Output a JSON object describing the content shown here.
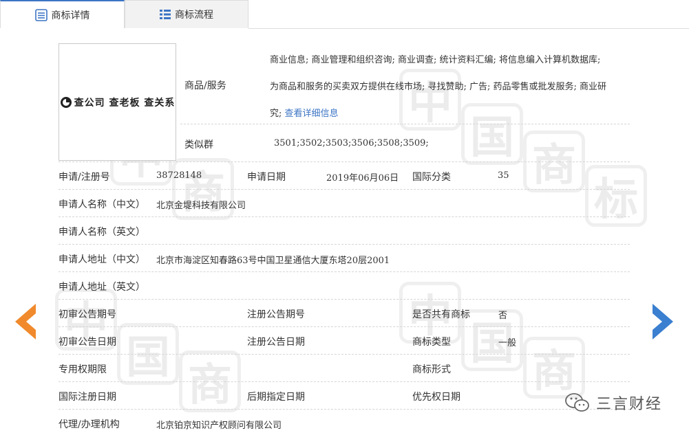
{
  "tabs": [
    {
      "label": "商标详情",
      "icon": "document-list-icon",
      "active": true
    },
    {
      "label": "商标流程",
      "icon": "list-icon",
      "active": false
    }
  ],
  "logo": {
    "text": "查公司  查老板  查关系",
    "icon": "qichacha-logo-icon"
  },
  "goods": {
    "label": "商品/服务",
    "line1": "商业信息; 商业管理和组织咨询; 商业调查; 统计资料汇编; 将信息编入计算机数据库;",
    "line2": "为商品和服务的买卖双方提供在线市场; 寻找赞助; 广告; 药品零售或批发服务; 商业研",
    "line3": "究;",
    "more_link": "查看详细信息"
  },
  "similar_group": {
    "label": "类似群",
    "value": "3501;3502;3503;3506;3508;3509;"
  },
  "rows": {
    "reg_no_label": "申请/注册号",
    "reg_no": "38728148",
    "apply_date_label": "申请日期",
    "apply_date": "2019年06月06日",
    "intl_class_label": "国际分类",
    "intl_class": "35",
    "applicant_cn_label": "申请人名称（中文）",
    "applicant_cn": "北京金堤科技有限公司",
    "applicant_en_label": "申请人名称（英文）",
    "applicant_en": "",
    "address_cn_label": "申请人地址（中文）",
    "address_cn": "北京市海淀区知春路63号中国卫星通信大厦东塔20层2001",
    "address_en_label": "申请人地址（英文）",
    "address_en": "",
    "prelim_no_label": "初审公告期号",
    "prelim_no": "",
    "reg_notice_no_label": "注册公告期号",
    "reg_notice_no": "",
    "shared_label": "是否共有商标",
    "shared": "否",
    "prelim_date_label": "初审公告日期",
    "prelim_date": "",
    "reg_notice_date_label": "注册公告日期",
    "reg_notice_date": "",
    "tm_type_label": "商标类型",
    "tm_type": "一般",
    "exclusive_label": "专用权期限",
    "exclusive": "",
    "tm_form_label": "商标形式",
    "tm_form": "",
    "intl_reg_date_label": "国际注册日期",
    "intl_reg_date": "",
    "later_date_label": "后期指定日期",
    "later_date": "",
    "priority_date_label": "优先权日期",
    "priority_date": "",
    "agent_label": "代理/办理机构",
    "agent": "北京铂京知识产权顾问有限公司"
  },
  "watermark": [
    "中",
    "国",
    "商",
    "标"
  ],
  "brand": {
    "text": "三言财经",
    "icon": "wechat-icon"
  },
  "colors": {
    "accent": "#3b74c4",
    "left_arrow": "#f08a2c",
    "right_arrow": "#3a7fd0"
  }
}
